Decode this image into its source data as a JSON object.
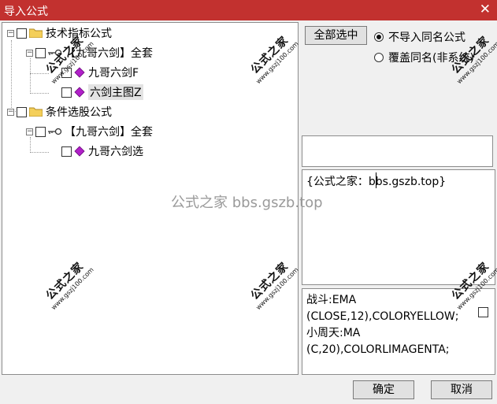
{
  "window": {
    "title": "导入公式",
    "close_glyph": "✕"
  },
  "tree": {
    "items": [
      {
        "label": "技术指标公式",
        "type": "folder"
      },
      {
        "label": "【九哥六剑】全套",
        "type": "key"
      },
      {
        "label": "九哥六剑F",
        "type": "formula"
      },
      {
        "label": "六剑主图Z",
        "type": "formula"
      },
      {
        "label": "条件选股公式",
        "type": "folder"
      },
      {
        "label": "【九哥六剑】全套",
        "type": "key"
      },
      {
        "label": "九哥六剑选",
        "type": "formula"
      }
    ]
  },
  "controls": {
    "select_all": "全部选中",
    "radio_skip": "不导入同名公式",
    "radio_overwrite": "覆盖同名(非系统)"
  },
  "preview": {
    "text": "{公式之家：bbs.gszb.top}"
  },
  "source": {
    "lines": [
      "战斗:EMA",
      "(CLOSE,12),COLORYELLOW;",
      "小周天:MA",
      "(C,20),COLORLIMAGENTA;"
    ]
  },
  "buttons": {
    "ok": "确定",
    "cancel": "取消"
  },
  "watermark": {
    "center": "公式之家 bbs.gszb.top",
    "stamp_title": "公式之家",
    "stamp_url": "www.gszj100.com"
  },
  "colors": {
    "titlebar": "#c2312f",
    "folder": "#f4cf5a",
    "gem": "#b020c8"
  }
}
